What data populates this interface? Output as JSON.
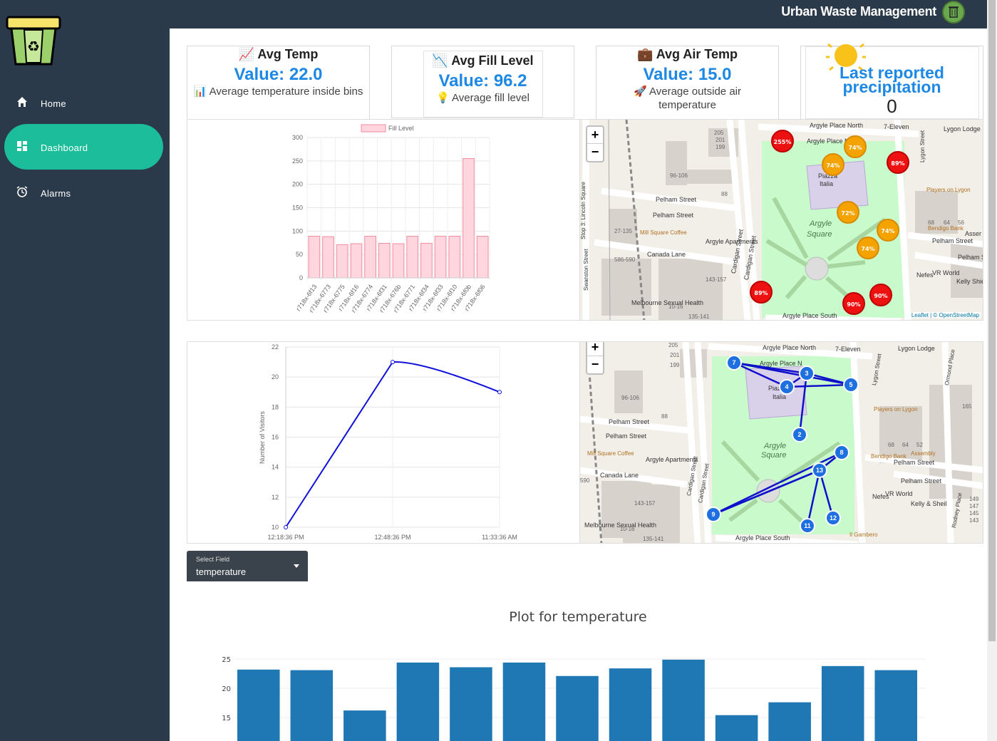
{
  "app": {
    "title": "Urban Waste Management"
  },
  "sidebar": {
    "items": [
      {
        "label": "Home",
        "icon": "home-icon"
      },
      {
        "label": "Dashboard",
        "icon": "dashboard-icon",
        "active": true
      },
      {
        "label": "Alarms",
        "icon": "alarm-icon"
      }
    ]
  },
  "cards": [
    {
      "title": "Avg Temp",
      "icon": "chart-up-icon",
      "value": "Value: 22.0",
      "desc_icon": "bar-chart-icon",
      "desc": "Average temperature inside bins"
    },
    {
      "title": "Avg Fill Level",
      "icon": "chart-down-icon",
      "value": "Value: 96.2",
      "desc_icon": "lightbulb-icon",
      "desc": "Average fill level"
    },
    {
      "title": "Avg Air Temp",
      "icon": "briefcase-icon",
      "value": "Value: 15.0",
      "desc_icon": "rocket-icon",
      "desc": "Average outside air temperature"
    },
    {
      "title": "Last reported precipitation",
      "icon": "sun-icon",
      "value": "0"
    }
  ],
  "fill_chart": {
    "type": "bar",
    "legend": "Fill Level",
    "categories": [
      "r718x-6f13",
      "r718x-6773",
      "r718x-6775",
      "r718x-6f16",
      "r718x-6774",
      "r718x-6f31",
      "r718x-676b",
      "r718x-6771",
      "r718x-6f34",
      "r718x-6f33",
      "r718x-6f10",
      "r718x-6f0b",
      "r718x-6f06"
    ],
    "values": [
      89,
      88,
      71,
      73,
      89,
      74,
      73,
      89,
      74,
      89,
      89,
      255,
      89
    ],
    "ylim": [
      0,
      300
    ],
    "yticks": [
      0,
      50,
      100,
      150,
      200,
      250,
      300
    ],
    "color": "#ffd6de",
    "border": "#f08ca0"
  },
  "visitors_chart": {
    "type": "line",
    "ylabel": "Number of Visitors",
    "x": [
      "12:18:36 PM",
      "12:48:36 PM",
      "11:33:36 AM"
    ],
    "values": [
      10,
      21,
      19
    ],
    "ylim": [
      10,
      22
    ],
    "yticks": [
      10,
      12,
      14,
      16,
      18,
      20,
      22
    ],
    "color": "#1010dd"
  },
  "map1": {
    "attribution": "Leaflet | © OpenStreetMap",
    "markers": [
      {
        "label": "255%",
        "color": "r"
      },
      {
        "label": "74%",
        "color": "o"
      },
      {
        "label": "74%",
        "color": "o"
      },
      {
        "label": "89%",
        "color": "r"
      },
      {
        "label": "72%",
        "color": "o"
      },
      {
        "label": "74%",
        "color": "o"
      },
      {
        "label": "74%",
        "color": "o"
      },
      {
        "label": "89%",
        "color": "r"
      },
      {
        "label": "90%",
        "color": "r"
      },
      {
        "label": "90%",
        "color": "r"
      }
    ],
    "labels": [
      "Argyle Place North",
      "Argyle Place N",
      "7-Eleven",
      "Lygon Lodge",
      "Piazza",
      "Italia",
      "Pelham Street",
      "Pelham Street",
      "Argyle",
      "Square",
      "Canada Lane",
      "Argyle Apartments",
      "Mill Square Coffee",
      "Cardigan Street",
      "Cardigan Street",
      "Players on Lygon",
      "Bendigo Bank",
      "Pelham Street",
      "Pelham Stre",
      "Nefes",
      "VR World",
      "Kelly Shie",
      "Melbourne Sexual Health",
      "Argyle Place South",
      "Stop 3: Lincoln Square",
      "Swanston Street",
      "Lygon Street",
      "Asser"
    ],
    "numbers": [
      "205",
      "201",
      "199",
      "96-106",
      "88",
      "27-135",
      "586-590",
      "143-157",
      "10-16",
      "135-141",
      "68",
      "64",
      "56"
    ]
  },
  "map2": {
    "nodes": [
      "7",
      "3",
      "4",
      "5",
      "2",
      "8",
      "13",
      "9",
      "11",
      "12"
    ],
    "labels": [
      "Argyle Place North",
      "7-Eleven",
      "Lygon Lodge",
      "Argyle Place N",
      "Piazza",
      "Italia",
      "Pelham Street",
      "Pelham Street",
      "Argyle",
      "Square",
      "Canada Lane",
      "Argyle Apartments",
      "Mill Square Coffee",
      "Cardigan Street",
      "Cardigan Street",
      "Players on Lygon",
      "Bendigo Bank",
      "Pelham Street",
      "Pelham Street",
      "Nefes",
      "VR World",
      "Kelly & Sheil",
      "Melbourne Sexual Health",
      "Argyle Place South",
      "Ormond Place",
      "Lygon Street",
      "Rodney Place",
      "Il Gambero",
      "Assembly"
    ],
    "numbers": [
      "205",
      "201",
      "199",
      "96-106",
      "88",
      "143-157",
      "10-16",
      "135-141",
      "68",
      "64",
      "52",
      "149",
      "147",
      "145",
      "143",
      "165",
      "590"
    ]
  },
  "select_field": {
    "label": "Select Field",
    "value": "temperature"
  },
  "temp_chart": {
    "title": "Plot for temperature",
    "type": "bar",
    "values": [
      23.2,
      23.1,
      16.2,
      24.4,
      23.6,
      24.4,
      22.1,
      23.4,
      24.9,
      15.4,
      17.6,
      23.8,
      23.1
    ],
    "yticks": [
      15,
      20,
      25
    ],
    "ylim": [
      10,
      26
    ],
    "color": "#1f77b4"
  }
}
